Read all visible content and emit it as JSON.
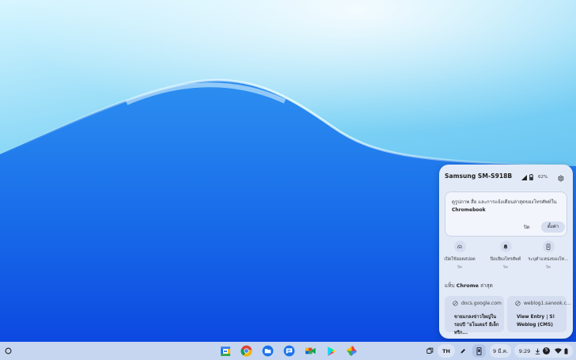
{
  "colors": {
    "wallpaper_top": "#bff0ff",
    "wallpaper_bottom": "#0a4ae0",
    "panel_bg": "#e3eaf7",
    "shelf_bg": "#c6d6f0",
    "accent": "#1a73e8"
  },
  "phone_hub": {
    "device_name": "Samsung SM-S918B",
    "battery_percent": "62%",
    "status_icons": [
      "signal-icon",
      "battery-icon"
    ],
    "settings_icon": "gear-icon",
    "notification": {
      "line1": "ดูรูปภาพ สื่อ และการแจ้งเตือนล่าสุดของโทรศัพท์ใน",
      "line2": "Chromebook",
      "dismiss_label": "ปิด",
      "settings_label": "ตั้งค่า"
    },
    "quick_settings": [
      {
        "icon": "hotspot-icon",
        "label": "เปิดใช้ฮอตสปอต",
        "state": "ปิด"
      },
      {
        "icon": "bell-icon",
        "label": "ปิดเสียงโทรศัพท์",
        "state": "ปิด"
      },
      {
        "icon": "phone-locate-icon",
        "label": "ระบุตำแหน่งของโท...",
        "state": "ปิด"
      }
    ],
    "recent_tabs_prefix": "แท็บ",
    "recent_tabs_brand": "Chrome",
    "recent_tabs_suffix": "ล่าสุด",
    "recent_tabs": [
      {
        "url": "docs.google.com",
        "title": "ขายแกลงข่าวใหญ่ในรอบปี \"อโนเดอร์ อีเล็กทริก...",
        "icon": "globe-icon"
      },
      {
        "url": "weblog1.sanook.c...",
        "title": "View Entry | S! Weblog (CMS)",
        "icon": "globe-icon"
      }
    ]
  },
  "shelf": {
    "launcher_icon": "launcher-icon",
    "pinned_apps": [
      {
        "name": "Calendar",
        "icon": "calendar-app-icon"
      },
      {
        "name": "Chrome",
        "icon": "chrome-app-icon"
      },
      {
        "name": "Files",
        "icon": "files-app-icon"
      },
      {
        "name": "Messages",
        "icon": "messages-app-icon"
      },
      {
        "name": "Meet",
        "icon": "meet-app-icon"
      },
      {
        "name": "Play Store",
        "icon": "play-store-app-icon"
      },
      {
        "name": "Photos",
        "icon": "photos-app-icon"
      }
    ],
    "tray": {
      "desk_icon": "virtual-desk-icon",
      "input_method": "TH",
      "pen_icon": "stylus-icon",
      "phone_icon": "phone-hub-icon",
      "date": "9 มี.ค.",
      "time": "9:29",
      "download_icon": "download-icon",
      "notification_count": "5",
      "wifi_icon": "wifi-icon",
      "battery_icon": "battery-icon"
    }
  }
}
